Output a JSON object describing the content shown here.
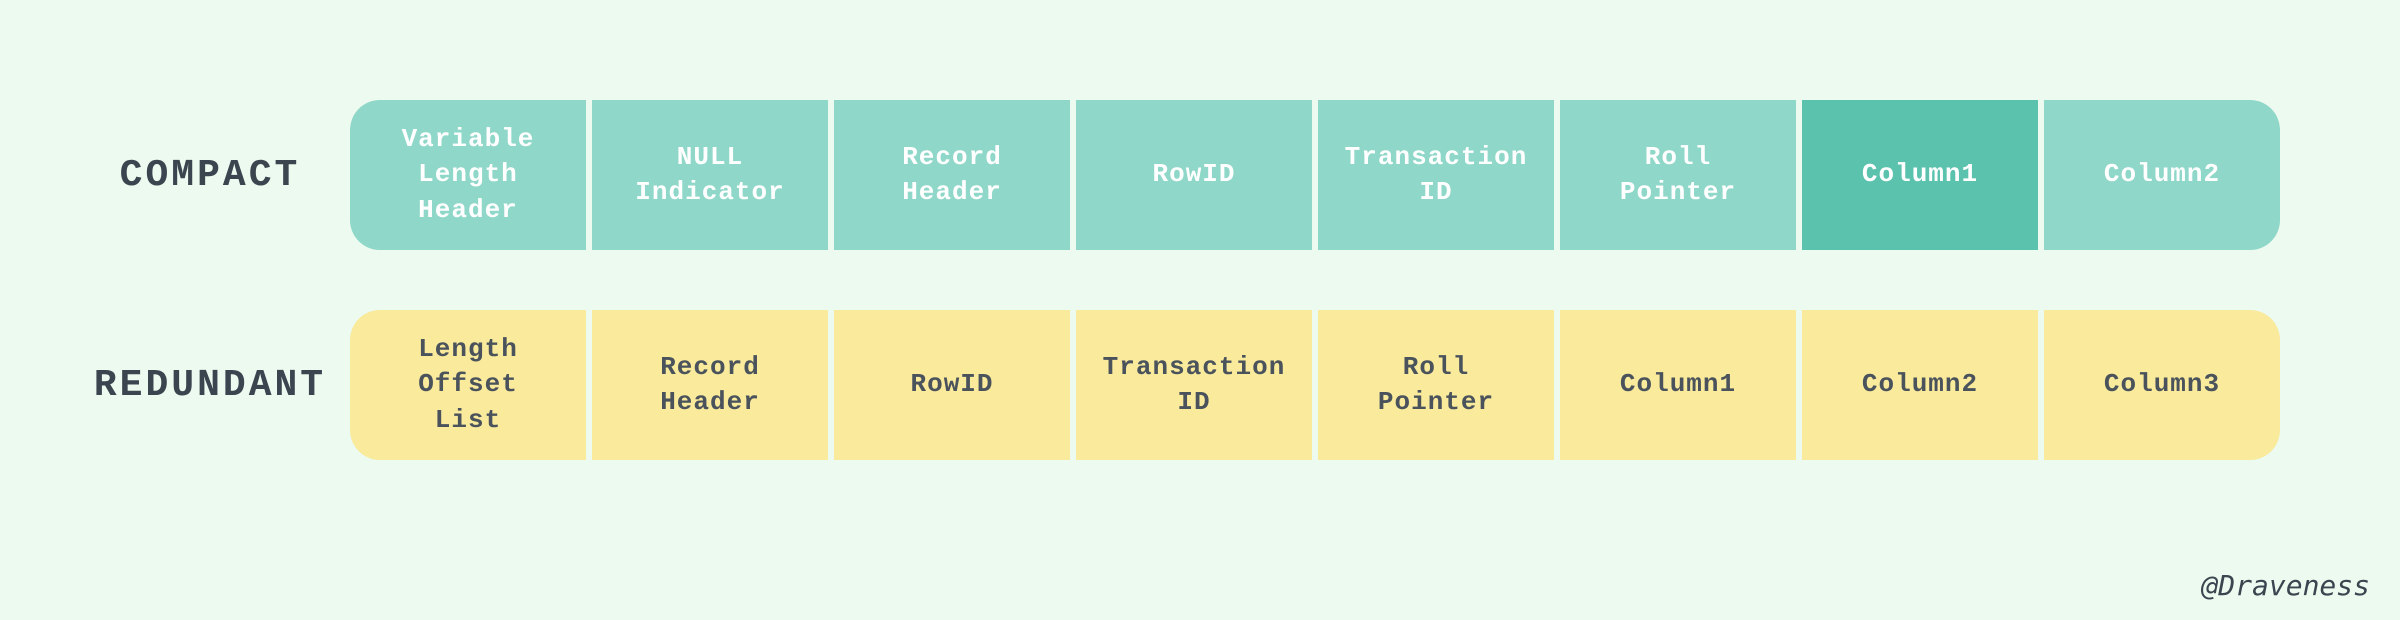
{
  "rows": [
    {
      "label": "COMPACT",
      "style": "teal",
      "cells": [
        {
          "text": "Variable\nLength\nHeader",
          "highlight": false
        },
        {
          "text": "NULL\nIndicator",
          "highlight": false
        },
        {
          "text": "Record\nHeader",
          "highlight": false
        },
        {
          "text": "RowID",
          "highlight": false
        },
        {
          "text": "Transaction\nID",
          "highlight": false
        },
        {
          "text": "Roll\nPointer",
          "highlight": false
        },
        {
          "text": "Column1",
          "highlight": true
        },
        {
          "text": "Column2",
          "highlight": false
        }
      ]
    },
    {
      "label": "REDUNDANT",
      "style": "yellow",
      "cells": [
        {
          "text": "Length\nOffset\nList",
          "highlight": false
        },
        {
          "text": "Record\nHeader",
          "highlight": false
        },
        {
          "text": "RowID",
          "highlight": false
        },
        {
          "text": "Transaction\nID",
          "highlight": false
        },
        {
          "text": "Roll\nPointer",
          "highlight": false
        },
        {
          "text": "Column1",
          "highlight": false
        },
        {
          "text": "Column2",
          "highlight": false
        },
        {
          "text": "Column3",
          "highlight": false
        }
      ]
    }
  ],
  "credit": "@Draveness"
}
